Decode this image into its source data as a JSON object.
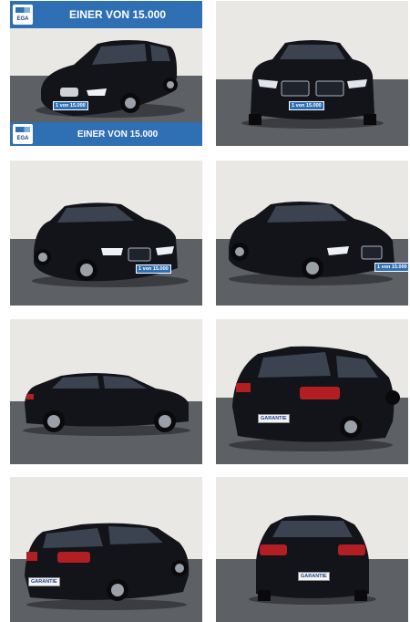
{
  "listing": {
    "banner_text": "EINER VON 15.000",
    "logo_text": "EGA",
    "plates": {
      "front": "1 von 15.000",
      "rear": "GARANTIE"
    }
  },
  "gallery": {
    "photos": [
      {
        "view": "front-left three-quarter"
      },
      {
        "view": "front"
      },
      {
        "view": "front-left three-quarter"
      },
      {
        "view": "front-right three-quarter"
      },
      {
        "view": "left side profile"
      },
      {
        "view": "rear-right three-quarter"
      },
      {
        "view": "rear-left three-quarter"
      },
      {
        "view": "rear"
      }
    ]
  },
  "colors": {
    "banner": "#2f6fb3",
    "car_paint": "#121419",
    "wall": "#e9e8e4",
    "floor": "#5d6064"
  }
}
